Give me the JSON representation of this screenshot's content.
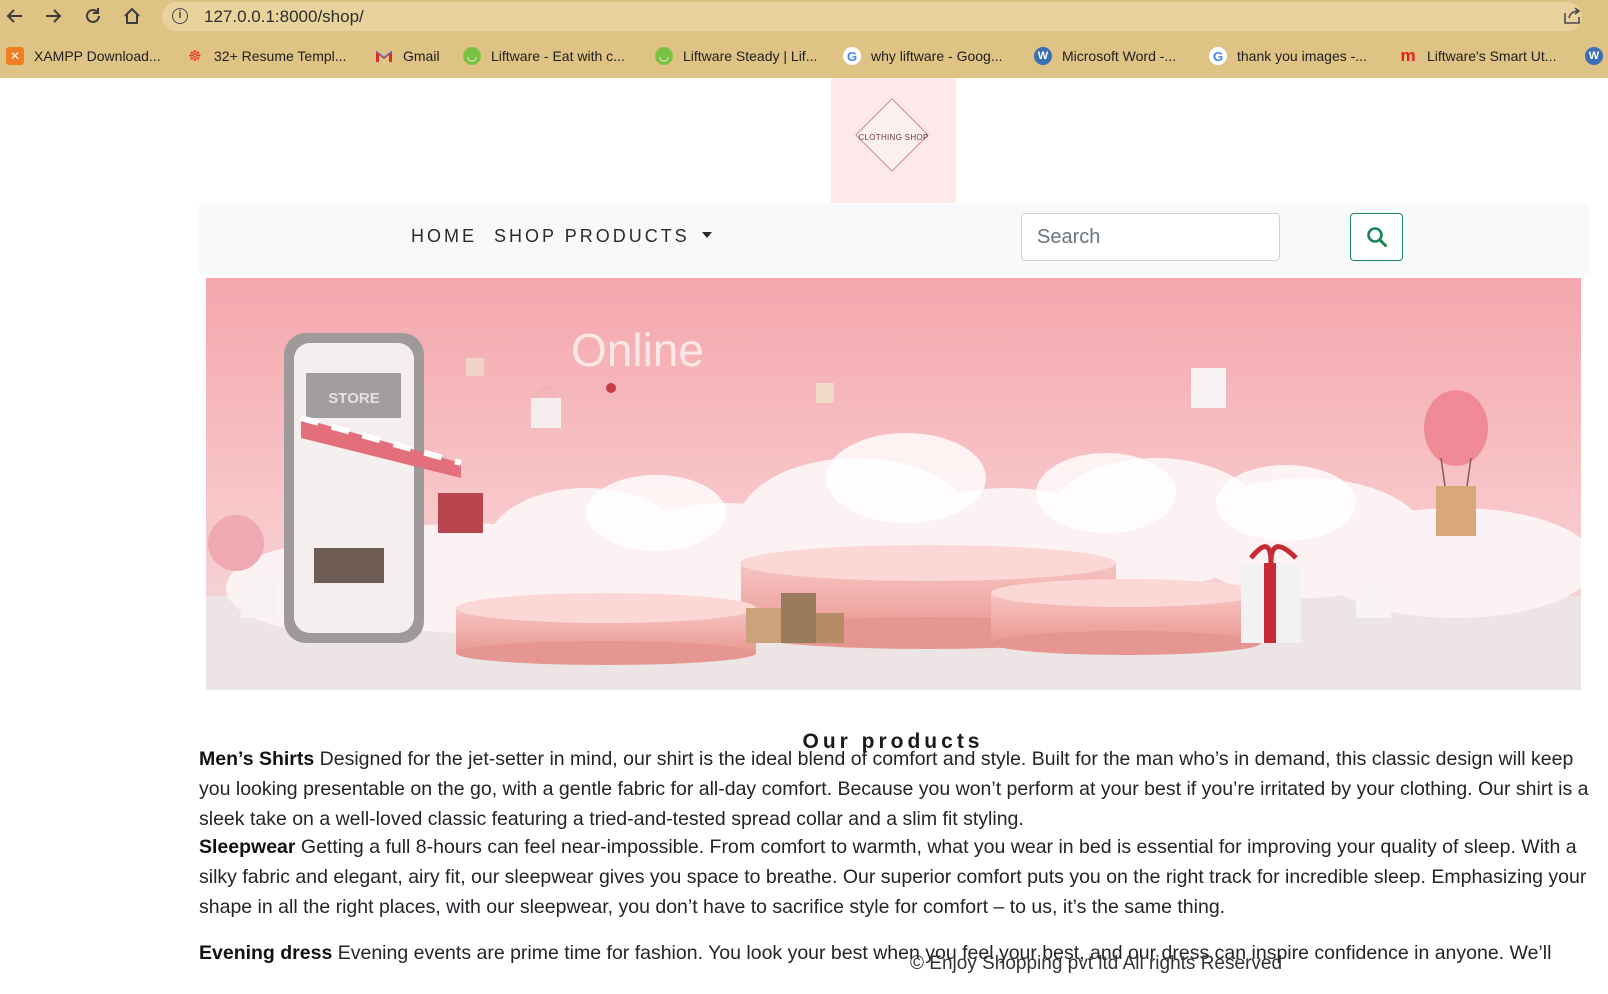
{
  "browser": {
    "url": "127.0.0.1:8000/shop/",
    "bookmarks": [
      {
        "label": "XAMPP Download...",
        "icon": "xampp-icon",
        "color": "#f07d21"
      },
      {
        "label": "32+ Resume Templ...",
        "icon": "resume-icon",
        "color": "#e0362c"
      },
      {
        "label": "Gmail",
        "icon": "gmail-icon",
        "color": "#d93025"
      },
      {
        "label": "Liftware - Eat with c...",
        "icon": "liftware-icon",
        "color": "#7cc242"
      },
      {
        "label": "Liftware Steady | Lif...",
        "icon": "liftware-icon",
        "color": "#7cc242"
      },
      {
        "label": "why liftware - Goog...",
        "icon": "google-icon",
        "color": "#4285f4"
      },
      {
        "label": "Microsoft Word -...",
        "icon": "wordpress-icon",
        "color": "#3a6fb5"
      },
      {
        "label": "thank you images -...",
        "icon": "google-icon",
        "color": "#4285f4"
      },
      {
        "label": "Liftware's Smart Ut...",
        "icon": "liftware-m-icon",
        "color": "#e02020"
      }
    ]
  },
  "logo": {
    "text": "CLOTHING SHOP"
  },
  "nav": {
    "home": "HOME",
    "shop": "SHOP PRODUCTS",
    "search_placeholder": "Search"
  },
  "banner": {
    "headline": "Online",
    "store_sign": "STORE"
  },
  "products": {
    "heading": "Our products",
    "items": [
      {
        "name": "Men’s Shirts",
        "text": "Designed for the jet-setter in mind, our shirt is the ideal blend of comfort and style. Built for the man who’s in demand, this classic design will keep you looking presentable on the go, with a gentle fabric for all-day comfort. Because you won’t perform at your best if you’re irritated by your clothing. Our shirt is a sleek take on a well-loved classic featuring a tried-and-tested spread collar and a slim fit styling."
      },
      {
        "name": "Sleepwear",
        "text": "Getting a full 8-hours can feel near-impossible. From comfort to warmth, what you wear in bed is essential for improving your quality of sleep. With a silky fabric and elegant, airy fit, our sleepwear gives you space to breathe. Our superior comfort puts you on the right track for incredible sleep. Emphasizing your shape in all the right places, with our sleepwear, you don’t have to sacrifice style for comfort – to us, it’s the same thing."
      },
      {
        "name": "Evening dress",
        "text": "Evening events are prime time for fashion. You look your best when you feel your best, and our dress can inspire confidence in anyone. We’ll"
      }
    ]
  },
  "footer": {
    "text": "© Enjoy Shopping pvt ltd All rights Reserved"
  },
  "colors": {
    "chrome": "#dfc384",
    "accent_green": "#198754",
    "banner_pink": "#f2a9ae"
  }
}
